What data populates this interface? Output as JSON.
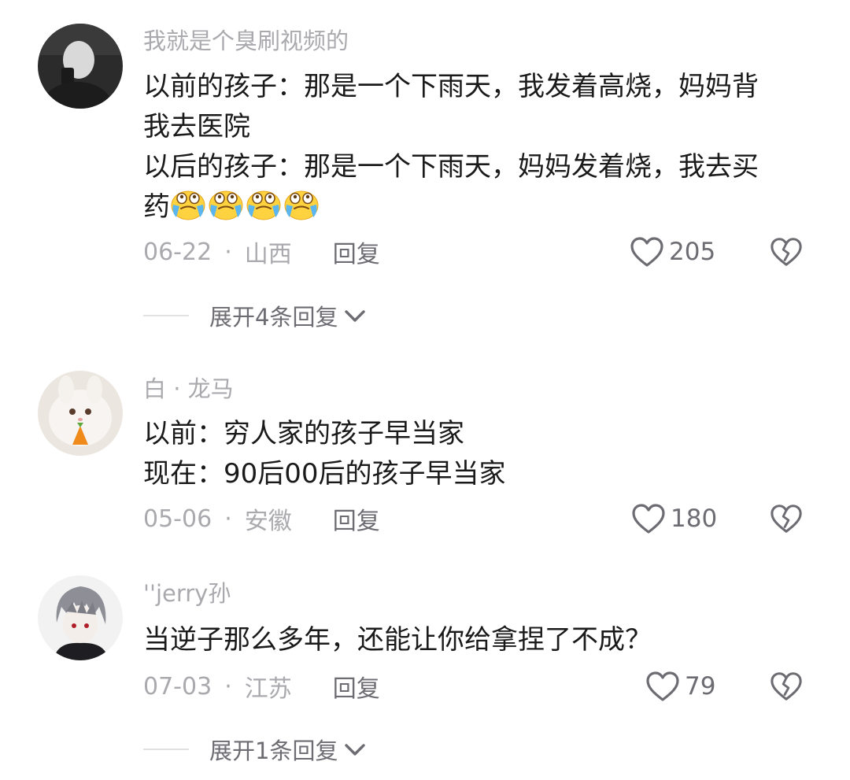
{
  "comments": [
    {
      "username": "我就是个臭刷视频的",
      "lines": [
        "以前的孩子：那是一个下雨天，我发着高烧，妈妈背",
        "我去医院",
        "以后的孩子：那是一个下雨天，妈妈发着烧，我去买",
        "药"
      ],
      "emojis": [
        "crying-laughing-emoji",
        "crying-laughing-emoji",
        "crying-laughing-emoji",
        "crying-laughing-emoji"
      ],
      "date": "06-22",
      "separator": "·",
      "location": "山西",
      "reply_label": "回复",
      "likes": "205",
      "expand_label": "展开4条回复"
    },
    {
      "username": "白 · 龙马",
      "lines": [
        "以前：穷人家的孩子早当家",
        "现在：90后00后的孩子早当家"
      ],
      "date": "05-06",
      "separator": "·",
      "location": "安徽",
      "reply_label": "回复",
      "likes": "180"
    },
    {
      "username": "''jerry孙",
      "lines": [
        "当逆子那么多年，还能让你给拿捏了不成？"
      ],
      "date": "07-03",
      "separator": "·",
      "location": "江苏",
      "reply_label": "回复",
      "likes": "79",
      "expand_label": "展开1条回复"
    }
  ],
  "colors": {
    "text": "#1a1a1a",
    "secondary": "#a9a9ae",
    "action": "#6c6c72",
    "background": "#ffffff"
  }
}
